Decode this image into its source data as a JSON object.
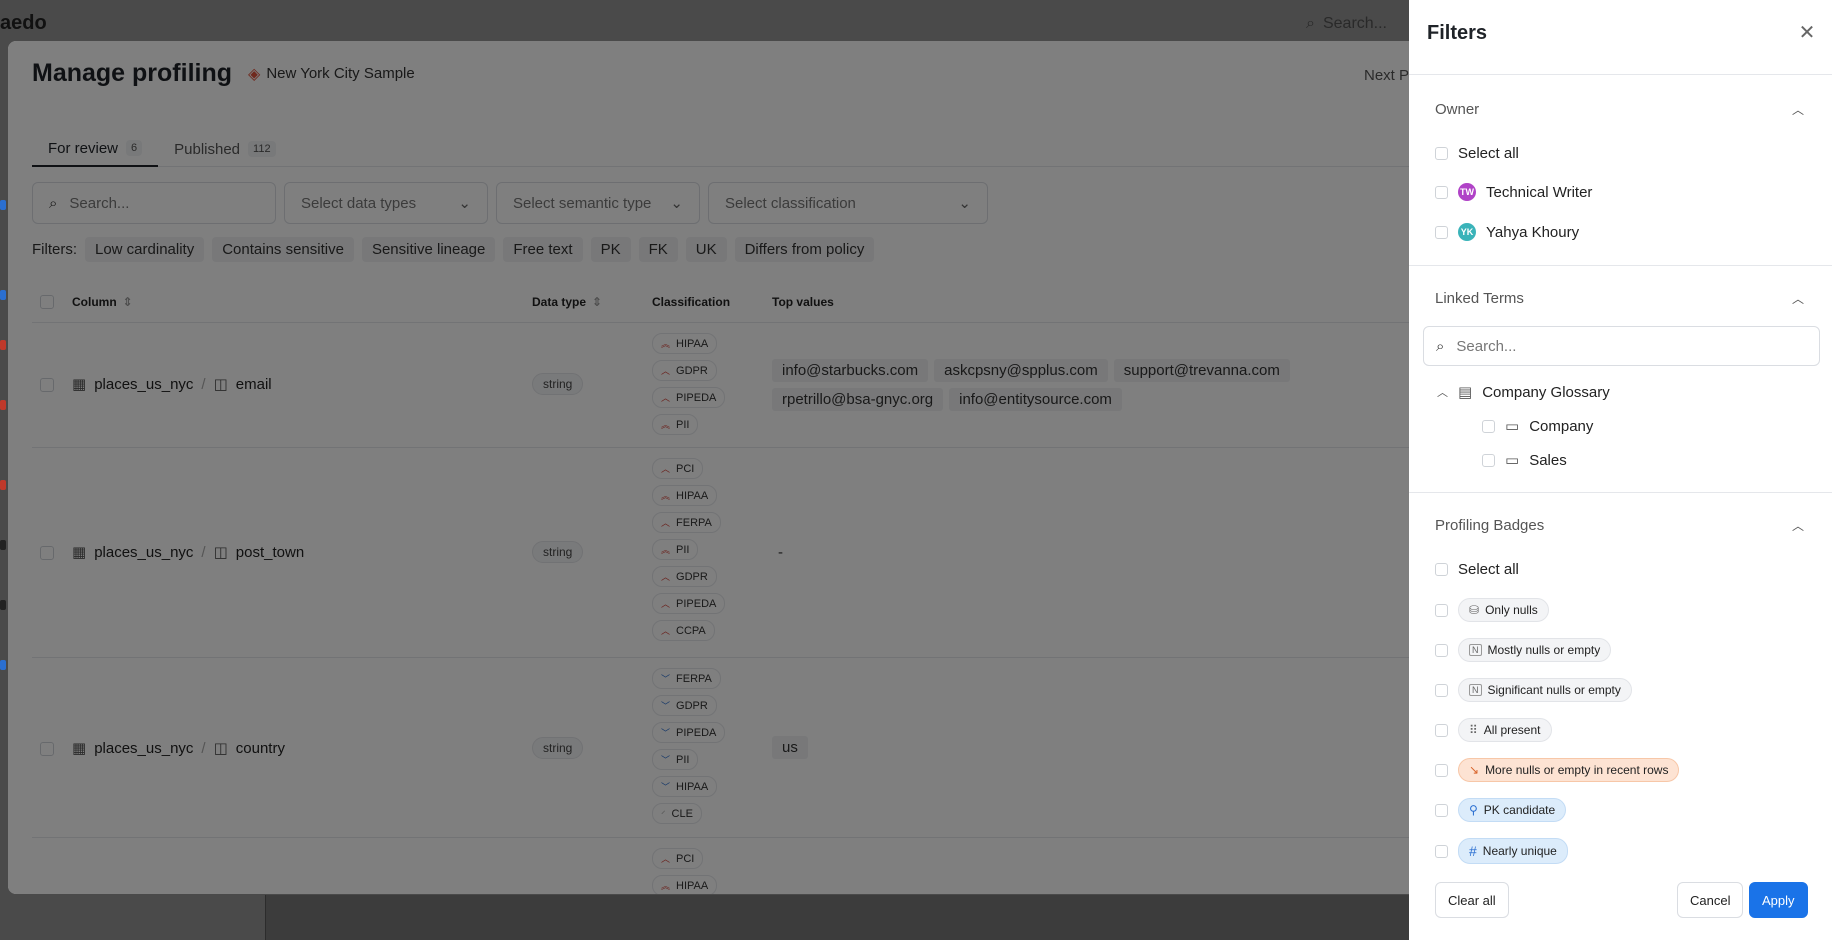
{
  "background": {
    "logo": "aedo",
    "search_placeholder": "Search..."
  },
  "modal": {
    "title": "Manage profiling",
    "datasource": "New York City Sample",
    "next_label": "Next P",
    "tabs": [
      {
        "label": "For review",
        "count": "6"
      },
      {
        "label": "Published",
        "count": "112"
      }
    ],
    "search_placeholder": "Search...",
    "selects": {
      "data_types": "Select data types",
      "semantic_type": "Select semantic type",
      "classification": "Select classification"
    },
    "filters_label": "Filters:",
    "chips": [
      "Low cardinality",
      "Contains sensitive",
      "Sensitive lineage",
      "Free text",
      "PK",
      "FK",
      "UK",
      "Differs from policy"
    ],
    "columns": {
      "column": "Column",
      "data_type": "Data type",
      "classification": "Classification",
      "top_values": "Top values"
    },
    "rows": [
      {
        "table": "places_us_nyc",
        "column": "email",
        "type": "string",
        "badges": [
          "HIPAA",
          "GDPR",
          "PIPEDA",
          "PII"
        ],
        "tops": [
          "info@starbucks.com",
          "askcpsny@spplus.com",
          "support@trevanna.com",
          "rpetrillo@bsa-gnyc.org",
          "info@entitysource.com"
        ]
      },
      {
        "table": "places_us_nyc",
        "column": "post_town",
        "type": "string",
        "badges": [
          "PCI",
          "HIPAA",
          "FERPA",
          "PII",
          "GDPR",
          "PIPEDA",
          "CCPA"
        ],
        "top_text": "-"
      },
      {
        "table": "places_us_nyc",
        "column": "country",
        "type": "string",
        "badges": [
          "FERPA",
          "GDPR",
          "PIPEDA",
          "PII",
          "HIPAA",
          "CLE"
        ],
        "tops": [
          "us"
        ]
      },
      {
        "badges": [
          "PCI",
          "HIPAA"
        ]
      }
    ]
  },
  "panel": {
    "title": "Filters",
    "owner": {
      "title": "Owner",
      "select_all": "Select all",
      "items": [
        {
          "initials": "TW",
          "name": "Technical Writer",
          "color": "#b042c7"
        },
        {
          "initials": "YK",
          "name": "Yahya Khoury",
          "color": "#3ab3b9"
        }
      ]
    },
    "linked_terms": {
      "title": "Linked Terms",
      "search_placeholder": "Search...",
      "glossary": "Company Glossary",
      "terms": [
        "Company",
        "Sales"
      ]
    },
    "profiling": {
      "title": "Profiling Badges",
      "select_all": "Select all",
      "badges": [
        {
          "label": "Only nulls",
          "style": "gray",
          "icon": "⛁"
        },
        {
          "label": "Mostly nulls or empty",
          "style": "gray",
          "icon": "N"
        },
        {
          "label": "Significant nulls or empty",
          "style": "gray",
          "icon": "N"
        },
        {
          "label": "All present",
          "style": "gray",
          "icon": "⠿"
        },
        {
          "label": "More nulls or empty in recent rows",
          "style": "orange",
          "icon": "↘"
        },
        {
          "label": "PK candidate",
          "style": "blue",
          "icon": "⚲"
        },
        {
          "label": "Nearly unique",
          "style": "blue",
          "icon": "#"
        }
      ]
    },
    "buttons": {
      "clear": "Clear all",
      "cancel": "Cancel",
      "apply": "Apply"
    }
  }
}
